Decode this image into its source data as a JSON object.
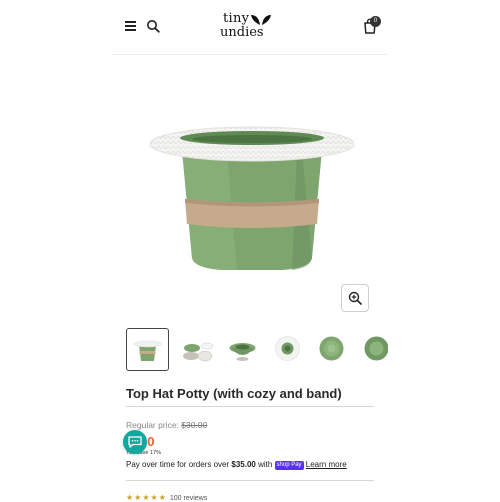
{
  "header": {
    "logo_line1": "tiny",
    "logo_line2": "undies",
    "cart_count": "0"
  },
  "product": {
    "title": "Top Hat Potty (with cozy and band)",
    "regular_price_label": "Regular price:",
    "regular_price": "$30.00",
    "sale_price": "00",
    "you_save": "You save 17%",
    "pay_prefix": "Pay over time for orders over ",
    "pay_threshold": "$35.00",
    "pay_with": " with ",
    "shop_pay": "shop Pay",
    "learn_more": "Learn more",
    "stars": "★★★★★",
    "reviews": "100 reviews"
  },
  "gallery": {
    "thumbnails": [
      "potty-front",
      "potty-parts",
      "potty-side",
      "potty-top",
      "potty-bowl",
      "potty-bowl-2"
    ],
    "active_index": 0
  },
  "colors": {
    "potty_green": "#7fa56f",
    "cozy_white": "#f4f4f2",
    "band_tan": "#c6aa8c",
    "sale_orange": "#e8623d",
    "chat_teal": "#11a8a0",
    "shop_pay_purple": "#5a31f4"
  },
  "icons": {
    "menu": "menu-icon",
    "search": "search-icon",
    "cart": "cart-icon",
    "zoom": "zoom-in-icon",
    "chat": "chat-icon"
  }
}
